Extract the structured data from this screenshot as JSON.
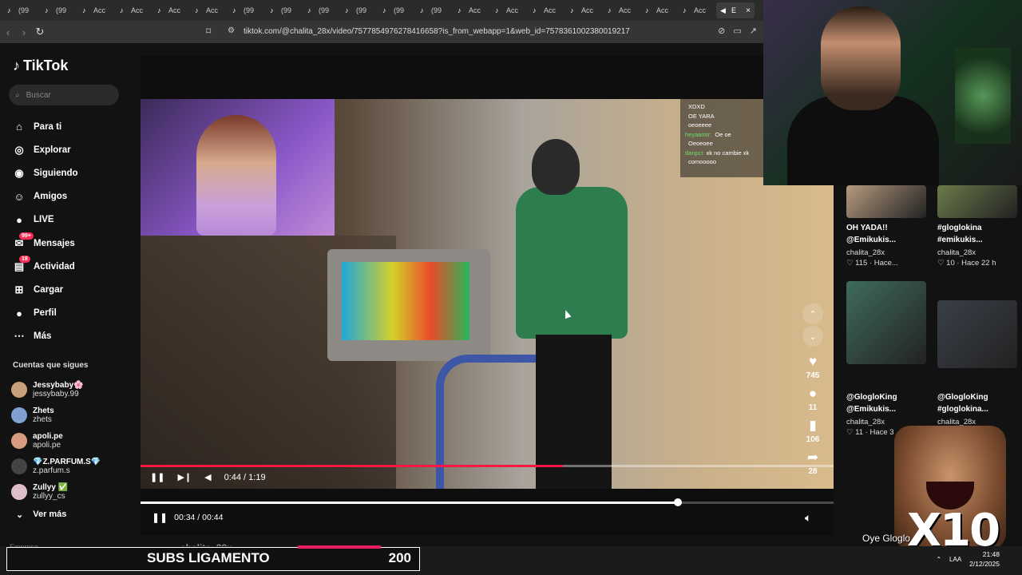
{
  "browser": {
    "tabs": [
      {
        "label": "(99"
      },
      {
        "label": "(99"
      },
      {
        "label": "Acc"
      },
      {
        "label": "Acc"
      },
      {
        "label": "Acc"
      },
      {
        "label": "Acc"
      },
      {
        "label": "(99"
      },
      {
        "label": "(99"
      },
      {
        "label": "(99"
      },
      {
        "label": "(99"
      },
      {
        "label": "(99"
      },
      {
        "label": "(99"
      },
      {
        "label": "Acc"
      },
      {
        "label": "Acc"
      },
      {
        "label": "Acc"
      },
      {
        "label": "Acc"
      },
      {
        "label": "Acc"
      },
      {
        "label": "Acc"
      },
      {
        "label": "Acc"
      }
    ],
    "active_tab": {
      "label": "E"
    },
    "url": "tiktok.com/@chalita_28x/video/7577854976278416658?is_from_webapp=1&web_id=7578361002380019217"
  },
  "sidebar": {
    "logo": "TikTok",
    "search_placeholder": "Buscar",
    "nav": [
      {
        "label": "Para ti",
        "icon": "home-icon",
        "glyph": "⌂"
      },
      {
        "label": "Explorar",
        "icon": "compass-icon",
        "glyph": "◎"
      },
      {
        "label": "Siguiendo",
        "icon": "following-icon",
        "glyph": "◉"
      },
      {
        "label": "Amigos",
        "icon": "friends-icon",
        "glyph": "☺"
      },
      {
        "label": "LIVE",
        "icon": "live-icon",
        "glyph": "●"
      },
      {
        "label": "Mensajes",
        "icon": "messages-icon",
        "glyph": "✉",
        "badge": "99+"
      },
      {
        "label": "Actividad",
        "icon": "activity-icon",
        "glyph": "▤",
        "badge": "18"
      },
      {
        "label": "Cargar",
        "icon": "upload-icon",
        "glyph": "⊞"
      },
      {
        "label": "Perfil",
        "icon": "profile-icon",
        "glyph": "●"
      },
      {
        "label": "Más",
        "icon": "more-icon",
        "glyph": "⋯"
      }
    ],
    "following_title": "Cuentas que sigues",
    "following": [
      {
        "name": "Jessybaby🌸",
        "user": "jessybaby.99",
        "color": "#c9a27c"
      },
      {
        "name": "Zhets",
        "user": "zhets",
        "color": "#7fa0d0"
      },
      {
        "name": "apoli.pe",
        "user": "apoli.pe",
        "color": "#d89a80"
      },
      {
        "name": "💎Z.PARFUM.S💎",
        "user": "z.parfum.s",
        "color": "#444444"
      },
      {
        "name": "Zullyy ✅",
        "user": "zullyy_cs",
        "color": "#e0c0c8"
      }
    ],
    "see_more": "Ver más",
    "footer_peek": "Empresa"
  },
  "video": {
    "chat": [
      {
        "user": "",
        "msg": "XDXD"
      },
      {
        "user": "",
        "msg": "OE YARA"
      },
      {
        "user": "",
        "msg": "oeoeeee"
      },
      {
        "user": "heyaamtr:",
        "msg": "Oe oe"
      },
      {
        "user": "",
        "msg": "Oeoeoee"
      },
      {
        "user": "danpct",
        "msg": "xk no cambie xk"
      },
      {
        "user": "",
        "msg": "comooooo"
      }
    ],
    "inner_time": "0:44 / 1:19",
    "inner_progress": 0.61,
    "likes": "745",
    "comments": "11",
    "saves": "106",
    "shares": "28",
    "main_time": "00:34 / 00:44",
    "main_progress": 0.775,
    "author_peek": "chalita_28x"
  },
  "recommended": [
    {
      "title1": "OH YADA!!",
      "title2": "@Emikukis...",
      "user": "chalita_28x",
      "meta": "♡ 115 · Hace...",
      "color": "#b59a7f"
    },
    {
      "title1": "#gloglokina",
      "title2": "#emikukis...",
      "user": "chalita_28x",
      "meta": "♡ 10 · Hace 22 h",
      "color": "#6b7a4a"
    },
    {
      "title1": "@GlogloKing",
      "title2": "@Emikukis...",
      "user": "chalita_28x",
      "meta": "♡ 11 · Hace 3",
      "color": "#3f6b5a"
    },
    {
      "title1": "@GlogloKing",
      "title2": "#gloglokina...",
      "user": "chalita_28x",
      "meta": "",
      "color": "#3a3f48"
    }
  ],
  "overlay": {
    "meme_text": "X10",
    "meme_caption": "Oye Gloglo"
  },
  "taskbar": {
    "subs_label": "SUBS LIGAMENTO",
    "subs_count": "200",
    "subs_progress": 0.2,
    "lang": "LAA",
    "time": "21:48",
    "date": "2/12/2025"
  }
}
